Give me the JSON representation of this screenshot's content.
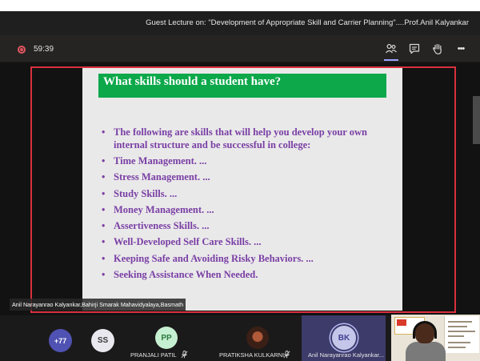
{
  "meeting": {
    "title": "Guest Lecture on: \"Development of Appropriate Skill and Carrier Planning\"....Prof.Anil Kalyankar",
    "timer": "59:39"
  },
  "controls": [
    {
      "icon": "participants-icon"
    },
    {
      "icon": "chat-icon"
    },
    {
      "icon": "raise-hand-icon"
    },
    {
      "icon": "more-options-icon",
      "glyph": "•••"
    }
  ],
  "slide": {
    "heading": "What skills should a student have?",
    "bullet_glyph": "•",
    "intro": "The following are skills that will help you develop your own internal structure and be successful in college:",
    "items": [
      "Time Management. ...",
      "Stress Management. ...",
      "Study Skills. ...",
      "Money Management. ...",
      "Assertiveness Skills. ...",
      "Well-Developed Self Care Skills. ...",
      "Keeping Safe and Avoiding Risky Behaviors. ...",
      "Seeking Assistance When Needed."
    ],
    "colors": {
      "heading_bg": "#0ca84a",
      "text": "#7a3fa5"
    }
  },
  "presenter_label": "Anil Narayanrao Kalyankar,Bahirji Smarak Mahavidyalaya,Basmath",
  "participants": {
    "overflow": "+77",
    "tiles": [
      {
        "initials": "SS",
        "name": ""
      },
      {
        "initials": "PP",
        "name": "PRANJALI PATIL"
      },
      {
        "initials": "",
        "name": "PRATIKSHA KULKARNI"
      },
      {
        "initials": "BK",
        "name": "Anil Narayanrao Kalyankar..."
      }
    ]
  },
  "colors": {
    "accent": "#9ea2ff",
    "record": "#e25560",
    "share_border": "#d9303f"
  }
}
